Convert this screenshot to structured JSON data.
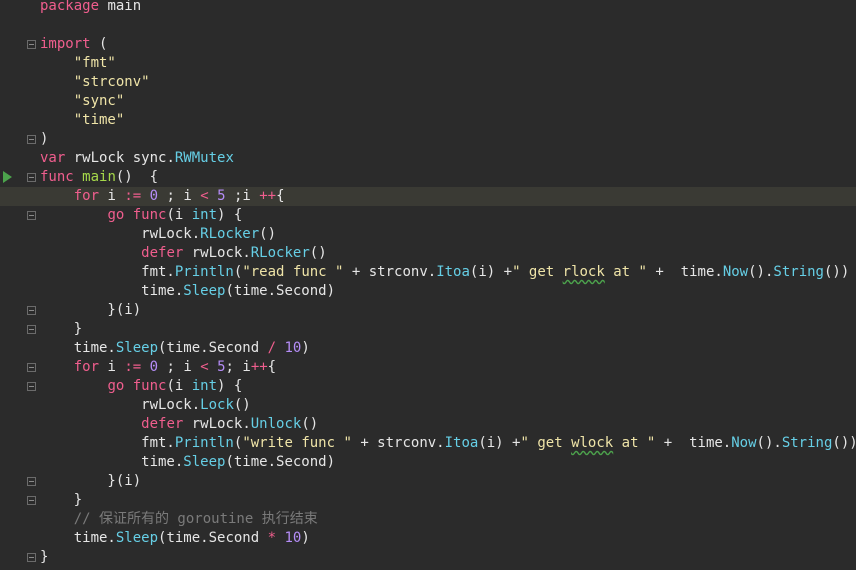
{
  "editor": {
    "language": "go",
    "colors": {
      "background": "#2b2b2b",
      "keyword": "#f05e8e",
      "function": "#a6d94a",
      "string": "#efe4a8",
      "number": "#b58df7",
      "type": "#66cfe6",
      "comment": "#7a7a7a",
      "text": "#e6e6e6",
      "current_line": "#3a3a34",
      "run_marker": "#4ca34c"
    },
    "current_line_index": 10,
    "run_marker_line_index": 9,
    "lines": [
      [
        {
          "t": "kw",
          "v": "package"
        },
        {
          "t": "plain",
          "v": " main"
        }
      ],
      [],
      [
        {
          "t": "kw",
          "v": "import"
        },
        {
          "t": "plain",
          "v": " ("
        }
      ],
      [
        {
          "t": "plain",
          "v": "    "
        },
        {
          "t": "str",
          "v": "\"fmt\""
        }
      ],
      [
        {
          "t": "plain",
          "v": "    "
        },
        {
          "t": "str",
          "v": "\"strconv\""
        }
      ],
      [
        {
          "t": "plain",
          "v": "    "
        },
        {
          "t": "str",
          "v": "\"sync\""
        }
      ],
      [
        {
          "t": "plain",
          "v": "    "
        },
        {
          "t": "str",
          "v": "\"time\""
        }
      ],
      [
        {
          "t": "plain",
          "v": ")"
        }
      ],
      [
        {
          "t": "kw",
          "v": "var"
        },
        {
          "t": "plain",
          "v": " rwLock sync."
        },
        {
          "t": "type",
          "v": "RWMutex"
        }
      ],
      [
        {
          "t": "kw",
          "v": "func"
        },
        {
          "t": "plain",
          "v": " "
        },
        {
          "t": "fn",
          "v": "main"
        },
        {
          "t": "plain",
          "v": "()  {"
        }
      ],
      [
        {
          "t": "plain",
          "v": "    "
        },
        {
          "t": "kw",
          "v": "for"
        },
        {
          "t": "plain",
          "v": " i "
        },
        {
          "t": "op",
          "v": ":="
        },
        {
          "t": "plain",
          "v": " "
        },
        {
          "t": "num",
          "v": "0"
        },
        {
          "t": "plain",
          "v": " ; i "
        },
        {
          "t": "op",
          "v": "<"
        },
        {
          "t": "plain",
          "v": " "
        },
        {
          "t": "num",
          "v": "5"
        },
        {
          "t": "plain",
          "v": " ;i "
        },
        {
          "t": "op",
          "v": "++"
        },
        {
          "t": "plain",
          "v": "{"
        }
      ],
      [
        {
          "t": "plain",
          "v": "        "
        },
        {
          "t": "kw",
          "v": "go"
        },
        {
          "t": "plain",
          "v": " "
        },
        {
          "t": "kw",
          "v": "func"
        },
        {
          "t": "plain",
          "v": "(i "
        },
        {
          "t": "type",
          "v": "int"
        },
        {
          "t": "plain",
          "v": ") {"
        }
      ],
      [
        {
          "t": "plain",
          "v": "            rwLock."
        },
        {
          "t": "method",
          "v": "RLocker"
        },
        {
          "t": "plain",
          "v": "()"
        }
      ],
      [
        {
          "t": "plain",
          "v": "            "
        },
        {
          "t": "kw",
          "v": "defer"
        },
        {
          "t": "plain",
          "v": " rwLock."
        },
        {
          "t": "method",
          "v": "RLocker"
        },
        {
          "t": "plain",
          "v": "()"
        }
      ],
      [
        {
          "t": "plain",
          "v": "            fmt."
        },
        {
          "t": "method",
          "v": "Println"
        },
        {
          "t": "plain",
          "v": "("
        },
        {
          "t": "str",
          "v": "\"read func \""
        },
        {
          "t": "plain",
          "v": " + strconv."
        },
        {
          "t": "method",
          "v": "Itoa"
        },
        {
          "t": "plain",
          "v": "(i) +"
        },
        {
          "t": "str",
          "v": "\" get "
        },
        {
          "t": "str squig",
          "v": "rlock"
        },
        {
          "t": "str",
          "v": " at \""
        },
        {
          "t": "plain",
          "v": " +  time."
        },
        {
          "t": "method",
          "v": "Now"
        },
        {
          "t": "plain",
          "v": "()."
        },
        {
          "t": "method",
          "v": "String"
        },
        {
          "t": "plain",
          "v": "())"
        }
      ],
      [
        {
          "t": "plain",
          "v": "            time."
        },
        {
          "t": "method",
          "v": "Sleep"
        },
        {
          "t": "plain",
          "v": "(time.Second)"
        }
      ],
      [
        {
          "t": "plain",
          "v": "        }(i)"
        }
      ],
      [
        {
          "t": "plain",
          "v": "    }"
        }
      ],
      [
        {
          "t": "plain",
          "v": "    time."
        },
        {
          "t": "method",
          "v": "Sleep"
        },
        {
          "t": "plain",
          "v": "(time.Second "
        },
        {
          "t": "op",
          "v": "/"
        },
        {
          "t": "plain",
          "v": " "
        },
        {
          "t": "num",
          "v": "10"
        },
        {
          "t": "plain",
          "v": ")"
        }
      ],
      [
        {
          "t": "plain",
          "v": "    "
        },
        {
          "t": "kw",
          "v": "for"
        },
        {
          "t": "plain",
          "v": " i "
        },
        {
          "t": "op",
          "v": ":="
        },
        {
          "t": "plain",
          "v": " "
        },
        {
          "t": "num",
          "v": "0"
        },
        {
          "t": "plain",
          "v": " ; i "
        },
        {
          "t": "op",
          "v": "<"
        },
        {
          "t": "plain",
          "v": " "
        },
        {
          "t": "num",
          "v": "5"
        },
        {
          "t": "plain",
          "v": "; i"
        },
        {
          "t": "op",
          "v": "++"
        },
        {
          "t": "plain",
          "v": "{"
        }
      ],
      [
        {
          "t": "plain",
          "v": "        "
        },
        {
          "t": "kw",
          "v": "go"
        },
        {
          "t": "plain",
          "v": " "
        },
        {
          "t": "kw",
          "v": "func"
        },
        {
          "t": "plain",
          "v": "(i "
        },
        {
          "t": "type",
          "v": "int"
        },
        {
          "t": "plain",
          "v": ") {"
        }
      ],
      [
        {
          "t": "plain",
          "v": "            rwLock."
        },
        {
          "t": "method",
          "v": "Lock"
        },
        {
          "t": "plain",
          "v": "()"
        }
      ],
      [
        {
          "t": "plain",
          "v": "            "
        },
        {
          "t": "kw",
          "v": "defer"
        },
        {
          "t": "plain",
          "v": " rwLock."
        },
        {
          "t": "method",
          "v": "Unlock"
        },
        {
          "t": "plain",
          "v": "()"
        }
      ],
      [
        {
          "t": "plain",
          "v": "            fmt."
        },
        {
          "t": "method",
          "v": "Println"
        },
        {
          "t": "plain",
          "v": "("
        },
        {
          "t": "str",
          "v": "\"write func \""
        },
        {
          "t": "plain",
          "v": " + strconv."
        },
        {
          "t": "method",
          "v": "Itoa"
        },
        {
          "t": "plain",
          "v": "(i) +"
        },
        {
          "t": "str",
          "v": "\" get "
        },
        {
          "t": "str squig",
          "v": "wlock"
        },
        {
          "t": "str",
          "v": " at \""
        },
        {
          "t": "plain",
          "v": " +  time."
        },
        {
          "t": "method",
          "v": "Now"
        },
        {
          "t": "plain",
          "v": "()."
        },
        {
          "t": "method",
          "v": "String"
        },
        {
          "t": "plain",
          "v": "())"
        }
      ],
      [
        {
          "t": "plain",
          "v": "            time."
        },
        {
          "t": "method",
          "v": "Sleep"
        },
        {
          "t": "plain",
          "v": "(time.Second)"
        }
      ],
      [
        {
          "t": "plain",
          "v": "        }(i)"
        }
      ],
      [
        {
          "t": "plain",
          "v": "    }"
        }
      ],
      [
        {
          "t": "plain",
          "v": "    "
        },
        {
          "t": "cmt",
          "v": "// 保证所有的 goroutine 执行结束"
        }
      ],
      [
        {
          "t": "plain",
          "v": "    time."
        },
        {
          "t": "method",
          "v": "Sleep"
        },
        {
          "t": "plain",
          "v": "(time.Second "
        },
        {
          "t": "op",
          "v": "*"
        },
        {
          "t": "plain",
          "v": " "
        },
        {
          "t": "num",
          "v": "10"
        },
        {
          "t": "plain",
          "v": ")"
        }
      ],
      [
        {
          "t": "plain",
          "v": "}"
        }
      ]
    ],
    "folds": [
      {
        "line": 2,
        "kind": "open"
      },
      {
        "line": 7,
        "kind": "close"
      },
      {
        "line": 9,
        "kind": "open"
      },
      {
        "line": 10,
        "kind": "open"
      },
      {
        "line": 11,
        "kind": "open"
      },
      {
        "line": 16,
        "kind": "close"
      },
      {
        "line": 17,
        "kind": "close"
      },
      {
        "line": 19,
        "kind": "open"
      },
      {
        "line": 20,
        "kind": "open"
      },
      {
        "line": 25,
        "kind": "close"
      },
      {
        "line": 26,
        "kind": "close"
      },
      {
        "line": 29,
        "kind": "close"
      }
    ]
  }
}
